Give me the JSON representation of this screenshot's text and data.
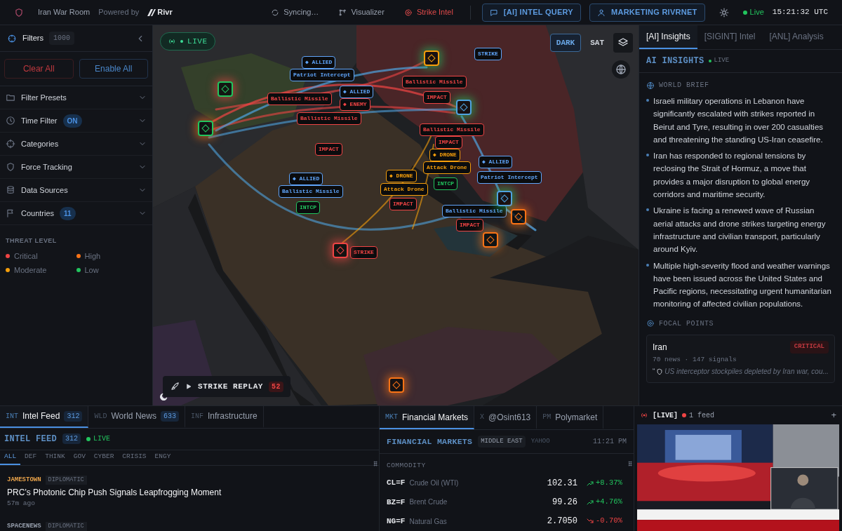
{
  "topbar": {
    "app_title": "Iran War Room",
    "powered_by": "Powered by",
    "brand": "Rivr",
    "nav": [
      {
        "label": "Syncing…",
        "kind": "sync",
        "selected": false
      },
      {
        "label": "Visualizer",
        "kind": "graph",
        "selected": false
      },
      {
        "label": "Strike Intel",
        "kind": "target",
        "selected": true
      }
    ],
    "buttons": [
      {
        "label": "[AI] INTEL QUERY",
        "kind": "chat"
      },
      {
        "label": "MARKETING RIVRNET",
        "kind": "user"
      }
    ],
    "status": "Live",
    "clock": "15:21:32 UTC"
  },
  "sidebar": {
    "title": "Filters",
    "count": "1000",
    "clear_label": "Clear All",
    "enable_label": "Enable All",
    "sections": [
      {
        "label": "Filter Presets",
        "kind": "folder"
      },
      {
        "label": "Time Filter",
        "kind": "clock",
        "badge": "ON"
      },
      {
        "label": "Categories",
        "kind": "crosshair"
      },
      {
        "label": "Force Tracking",
        "kind": "shield"
      },
      {
        "label": "Data Sources",
        "kind": "database"
      },
      {
        "label": "Countries",
        "kind": "flag",
        "badge": "11"
      }
    ],
    "threat_title": "THREAT LEVEL",
    "threat_levels": [
      {
        "label": "Critical",
        "color": "#ef4444"
      },
      {
        "label": "High",
        "color": "#f97316"
      },
      {
        "label": "Moderate",
        "color": "#f59e0b"
      },
      {
        "label": "Low",
        "color": "#22c55e"
      }
    ]
  },
  "map": {
    "live_label": "LIVE",
    "styles": [
      {
        "label": "DARK",
        "selected": true
      },
      {
        "label": "SAT",
        "selected": false
      }
    ],
    "markers": [
      {
        "text": "◆ ALLIED",
        "color": "#60a5fa"
      },
      {
        "text": "Patriot Intercept",
        "color": "#60a5fa"
      },
      {
        "text": "◆ ALLIED",
        "color": "#60a5fa"
      },
      {
        "text": "◆ ENEMY",
        "color": "#ef4444"
      },
      {
        "text": "Ballistic Missile",
        "color": "#ef4444"
      },
      {
        "text": "Ballistic Missile",
        "color": "#ef4444"
      },
      {
        "text": "Ballistic Missile",
        "color": "#ef4444"
      },
      {
        "text": "IMPACT",
        "color": "#ef4444"
      },
      {
        "text": "IMPACT",
        "color": "#ef4444"
      },
      {
        "text": "Ballistic Missile",
        "color": "#ef4444"
      },
      {
        "text": "IMPACT",
        "color": "#ef4444"
      },
      {
        "text": "◆ DRONE",
        "color": "#f59e0b"
      },
      {
        "text": "Attack Drone",
        "color": "#f59e0b"
      },
      {
        "text": "INTCP",
        "color": "#22c55e"
      },
      {
        "text": "◆ DRONE",
        "color": "#f59e0b"
      },
      {
        "text": "Attack Drone",
        "color": "#f59e0b"
      },
      {
        "text": "IMPACT",
        "color": "#ef4444"
      },
      {
        "text": "◆ ALLIED",
        "color": "#60a5fa"
      },
      {
        "text": "Ballistic Missile",
        "color": "#60a5fa"
      },
      {
        "text": "INTCP",
        "color": "#22c55e"
      },
      {
        "text": "◆ ALLIED",
        "color": "#60a5fa"
      },
      {
        "text": "Patriot Intercept",
        "color": "#60a5fa"
      },
      {
        "text": "Ballistic Missile",
        "color": "#60a5fa"
      },
      {
        "text": "IMPACT",
        "color": "#ef4444"
      },
      {
        "text": "STRIKE",
        "color": "#ef4444"
      },
      {
        "text": "STRIKE",
        "color": "#60a5fa"
      }
    ],
    "replay": {
      "label": "STRIKE REPLAY",
      "count": "52"
    }
  },
  "insights": {
    "tabs": [
      {
        "label": "[AI] Insights",
        "selected": true
      },
      {
        "label": "[SIGINT] Intel",
        "selected": false
      },
      {
        "label": "[ANL] Analysis",
        "selected": false
      }
    ],
    "title": "AI INSIGHTS",
    "live": "LIVE",
    "brief_title": "WORLD BRIEF",
    "brief": [
      "Israeli military operations in Lebanon have significantly escalated with strikes reported in Beirut and Tyre, resulting in over 200 casualties and threatening the standing US-Iran ceasefire.",
      "Iran has responded to regional tensions by reclosing the Strait of Hormuz, a move that provides a major disruption to global energy corridors and maritime security.",
      "Ukraine is facing a renewed wave of Russian aerial attacks and drone strikes targeting energy infrastructure and civilian transport, particularly around Kyiv.",
      "Multiple high-severity flood and weather warnings have been issued across the United States and Pacific regions, necessitating urgent humanitarian monitoring of affected civilian populations."
    ],
    "focal_title": "FOCAL POINTS",
    "focal_points": [
      {
        "name": "Iran",
        "level": "CRITICAL",
        "stats": "70 news · 147 signals",
        "quote_mark": "“",
        "quote": "US interceptor stockpiles depleted by Iran war, cou..."
      }
    ]
  },
  "feed": {
    "tabs": [
      {
        "code": "INT",
        "label": "Intel Feed",
        "count": "312",
        "selected": true
      },
      {
        "code": "WLD",
        "label": "World News",
        "count": "633",
        "selected": false
      },
      {
        "code": "INF",
        "label": "Infrastructure",
        "selected": false
      }
    ],
    "title": "INTEL FEED",
    "count": "312",
    "live": "LIVE",
    "filters": [
      {
        "label": "ALL",
        "selected": true
      },
      {
        "label": "DEF",
        "selected": false
      },
      {
        "label": "THINK",
        "selected": false
      },
      {
        "label": "GOV",
        "selected": false
      },
      {
        "label": "CYBER",
        "selected": false
      },
      {
        "label": "CRISIS",
        "selected": false
      },
      {
        "label": "ENGY",
        "selected": false
      }
    ],
    "items": [
      {
        "source": "JAMESTOWN",
        "category": "DIPLOMATIC",
        "headline": "PRC’s Photonic Chip Push Signals Leapfrogging Moment",
        "age": "57m ago"
      },
      {
        "source": "SPACENEWS",
        "category": "DIPLOMATIC"
      }
    ]
  },
  "markets": {
    "tabs": [
      {
        "code": "MKT",
        "label": "Financial Markets",
        "selected": true
      },
      {
        "code": "X",
        "label": "@Osint613",
        "selected": false
      },
      {
        "code": "PM",
        "label": "Polymarket",
        "selected": false
      }
    ],
    "title": "FINANCIAL MARKETS",
    "region": "MIDDLE EAST",
    "provider": "YAHOO",
    "time": "11:21 PM",
    "group": "COMMODITY",
    "rows": [
      {
        "symbol": "CL=F",
        "name": "Crude Oil (WTI)",
        "price": "102.31",
        "change": "+8.37%",
        "rising": true
      },
      {
        "symbol": "BZ=F",
        "name": "Brent Crude",
        "price": "99.26",
        "change": "+4.76%",
        "rising": true
      },
      {
        "symbol": "NG=F",
        "name": "Natural Gas",
        "price": "2.7050",
        "change": "-0.70%",
        "rising": false
      }
    ]
  },
  "video": {
    "live_label": "[LIVE]",
    "feeds": "1 feed",
    "add": "+"
  }
}
